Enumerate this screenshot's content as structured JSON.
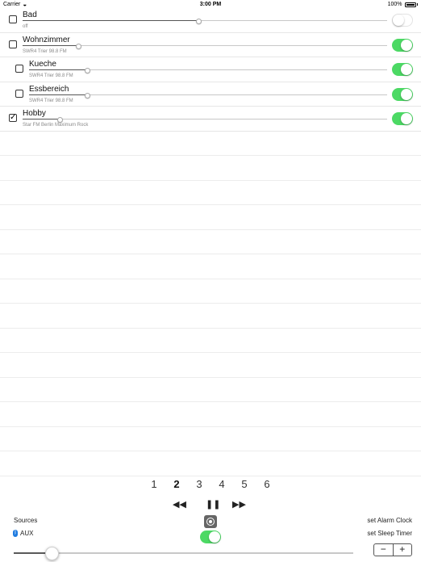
{
  "status_bar": {
    "carrier": "Carrier",
    "time": "3:00 PM",
    "battery": "100%"
  },
  "zones": [
    {
      "name": "Bad",
      "source": "off",
      "checked": false,
      "on": false,
      "volume": 0.48,
      "indent": false
    },
    {
      "name": "Wohnzimmer",
      "source": "SWR4 Trier 98.8 FM",
      "checked": false,
      "on": true,
      "volume": 0.15,
      "indent": false
    },
    {
      "name": "Kueche",
      "source": "SWR4 Trier 98.8 FM",
      "checked": false,
      "on": true,
      "volume": 0.16,
      "indent": true
    },
    {
      "name": "Essbereich",
      "source": "SWR4 Trier 98.8 FM",
      "checked": false,
      "on": true,
      "volume": 0.16,
      "indent": true
    },
    {
      "name": "Hobby",
      "source": "Star FM Berlin Maximum Rock",
      "checked": true,
      "on": true,
      "volume": 0.1,
      "indent": false
    }
  ],
  "presets": [
    "1",
    "2",
    "3",
    "4",
    "5",
    "6"
  ],
  "active_preset": "2",
  "controls": {
    "rewind": "◀◀",
    "pause": "❚❚",
    "forward": "▶▶",
    "sources_label": "Sources",
    "current_source": "AUX",
    "alarm_label": "set Alarm Clock",
    "sleep_label": "set Sleep Timer",
    "stepper_minus": "−",
    "stepper_plus": "+",
    "master_toggle_on": true,
    "master_volume": 0.11
  },
  "colors": {
    "toggle_on": "#4cd964",
    "bluetooth": "#1e7be0"
  }
}
